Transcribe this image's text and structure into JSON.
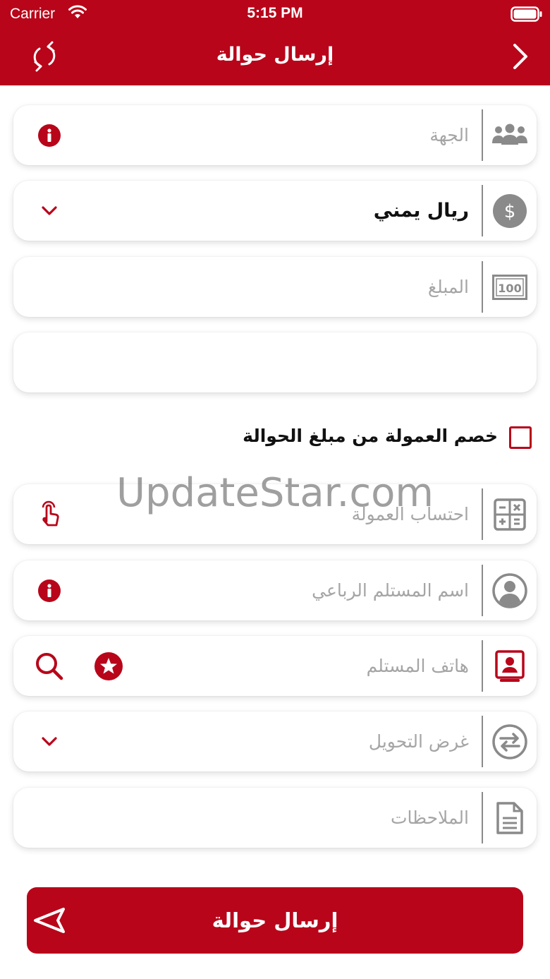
{
  "status_bar": {
    "carrier": "Carrier",
    "time": "5:15 PM"
  },
  "header": {
    "title": "إرسال حوالة"
  },
  "form": {
    "entity": {
      "placeholder": "الجهة",
      "icon": "group-icon",
      "action_icon": "info-icon"
    },
    "currency": {
      "value": "ريال يمني",
      "icon": "dollar-icon",
      "action_icon": "chevron-down-icon"
    },
    "amount": {
      "placeholder": "المبلغ",
      "icon": "banknote-icon"
    },
    "extra": {
      "value": ""
    },
    "deduct_commission": {
      "label": "خصم العمولة من مبلغ الحوالة",
      "checked": false
    },
    "calc_commission": {
      "placeholder": "احتساب العمولة",
      "icon": "calculator-icon",
      "action_icon": "tap-icon"
    },
    "recipient_name": {
      "placeholder": "اسم المستلم الرباعي",
      "icon": "user-icon",
      "action_icon": "info-icon"
    },
    "recipient_phone": {
      "placeholder": "هاتف المستلم",
      "icon": "contact-card-icon",
      "action_icons": [
        "search-icon",
        "star-icon"
      ]
    },
    "purpose": {
      "placeholder": "غرض التحويل",
      "icon": "exchange-icon",
      "action_icon": "chevron-down-icon"
    },
    "notes": {
      "placeholder": "الملاحظات",
      "icon": "document-icon"
    }
  },
  "submit": {
    "label": "إرسال حوالة",
    "icon": "send-icon"
  },
  "watermark": "UpdateStar.com",
  "colors": {
    "primary": "#b8051a",
    "icon_gray": "#8a8a8a",
    "placeholder": "#a5a5a5"
  }
}
